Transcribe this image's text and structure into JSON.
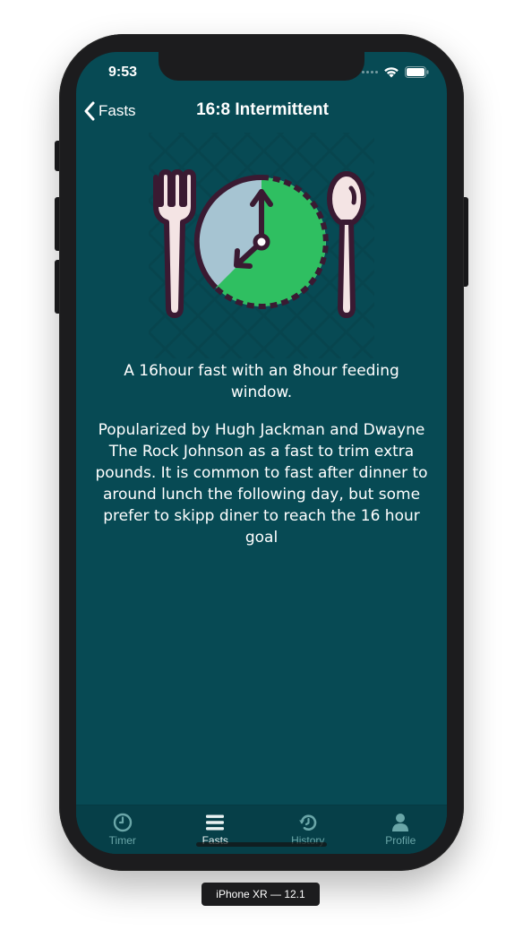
{
  "status_bar": {
    "time": "9:53",
    "icons": [
      "cellular-signal-icon",
      "wifi-icon",
      "battery-icon"
    ]
  },
  "nav": {
    "back_label": "Fasts",
    "title": "16:8 Intermittent"
  },
  "illustration": {
    "icon": "fork-clock-spoon-icon",
    "colors": {
      "plate_green": "#2fbf61",
      "plate_blue": "#a6c4d2",
      "outline": "#3a1a32",
      "cutlery": "#f4e4e4"
    }
  },
  "content": {
    "summary": "A 16hour fast with an 8hour feeding window.",
    "description": "Popularized by Hugh Jackman and Dwayne The Rock Johnson as a fast to trim extra pounds. It is common to fast after dinner to around lunch the following day, but some prefer to skipp diner to reach the 16 hour goal"
  },
  "tabbar": {
    "tabs": [
      {
        "label": "Timer",
        "icon": "clock-icon",
        "active": false
      },
      {
        "label": "Fasts",
        "icon": "list-icon",
        "active": true
      },
      {
        "label": "History",
        "icon": "history-icon",
        "active": false
      },
      {
        "label": "Profile",
        "icon": "person-icon",
        "active": false
      }
    ]
  },
  "device_label": "iPhone XR — 12.1",
  "colors": {
    "background": "#074a54",
    "tabbar": "#063f48",
    "tab_inactive": "#6aa6a8",
    "tab_active": "#e9f2f2"
  }
}
